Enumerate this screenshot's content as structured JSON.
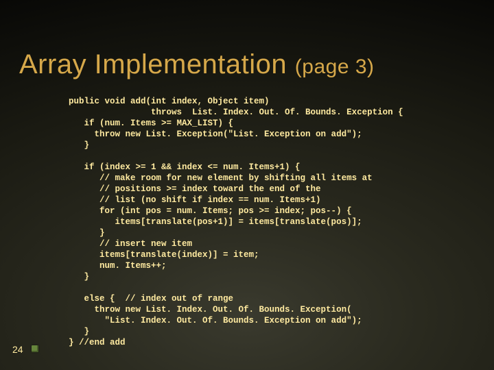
{
  "slide_number": "24",
  "title": {
    "main": "Array Implementation ",
    "page": "(page 3)"
  },
  "code": {
    "l01": "public void add(int index, Object item)",
    "l02": "                throws  List. Index. Out. Of. Bounds. Exception {",
    "l03": "   if (num. Items >= MAX_LIST) {",
    "l04": "     throw new List. Exception(\"List. Exception on add\");",
    "l05": "   }",
    "l06": "",
    "l07": "   if (index >= 1 && index <= num. Items+1) {",
    "l08": "      // make room for new element by shifting all items at",
    "l09": "      // positions >= index toward the end of the",
    "l10": "      // list (no shift if index == num. Items+1)",
    "l11": "      for (int pos = num. Items; pos >= index; pos--) {",
    "l12": "         items[translate(pos+1)] = items[translate(pos)];",
    "l13": "      }",
    "l14": "      // insert new item",
    "l15": "      items[translate(index)] = item;",
    "l16": "      num. Items++;",
    "l17": "   }",
    "l18": "",
    "l19": "   else {  // index out of range",
    "l20": "     throw new List. Index. Out. Of. Bounds. Exception(",
    "l21": "       \"List. Index. Out. Of. Bounds. Exception on add\");",
    "l22": "   }",
    "l23": "} //end add"
  }
}
